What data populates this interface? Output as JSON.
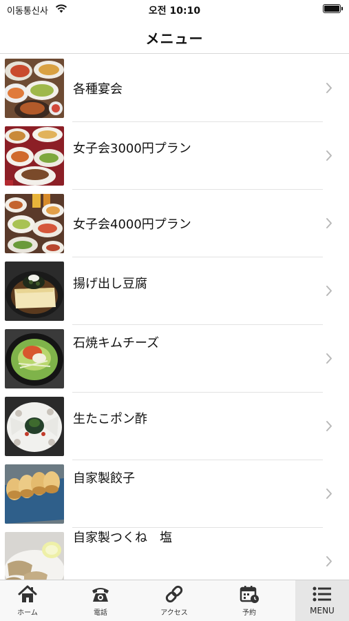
{
  "status_bar": {
    "carrier": "이동통신사",
    "time": "오전 10:10"
  },
  "nav": {
    "title": "メニュー"
  },
  "menu_items": [
    {
      "label": "各種宴会",
      "image": "party-platter-photo"
    },
    {
      "label": "女子会3000円プラン",
      "image": "course-spread-photo"
    },
    {
      "label": "女子会4000円プラン",
      "image": "course-drinks-photo"
    },
    {
      "label": "揚げ出し豆腐",
      "image": "agedashi-tofu-photo"
    },
    {
      "label": "石焼キムチーズ",
      "image": "stone-kimchi-photo"
    },
    {
      "label": "生たこポン酢",
      "image": "octopus-ponzu-photo"
    },
    {
      "label": "自家製餃子",
      "image": "gyoza-photo"
    },
    {
      "label": "自家製つくね　塩",
      "image": "tsukune-photo"
    }
  ],
  "tab_bar": {
    "tabs": [
      {
        "label": "ホーム",
        "icon": "home-icon"
      },
      {
        "label": "電話",
        "icon": "phone-icon"
      },
      {
        "label": "アクセス",
        "icon": "link-icon"
      },
      {
        "label": "予約",
        "icon": "calendar-icon"
      },
      {
        "label": "MENU",
        "icon": "list-icon"
      }
    ],
    "active_index": 4
  },
  "colors": {
    "divider": "#e2e2e2",
    "chevron": "#b8b8b8",
    "tab_bar_bg": "#f8f8f8",
    "active_tab_bg": "#e6e6e6",
    "icon": "#333333"
  }
}
